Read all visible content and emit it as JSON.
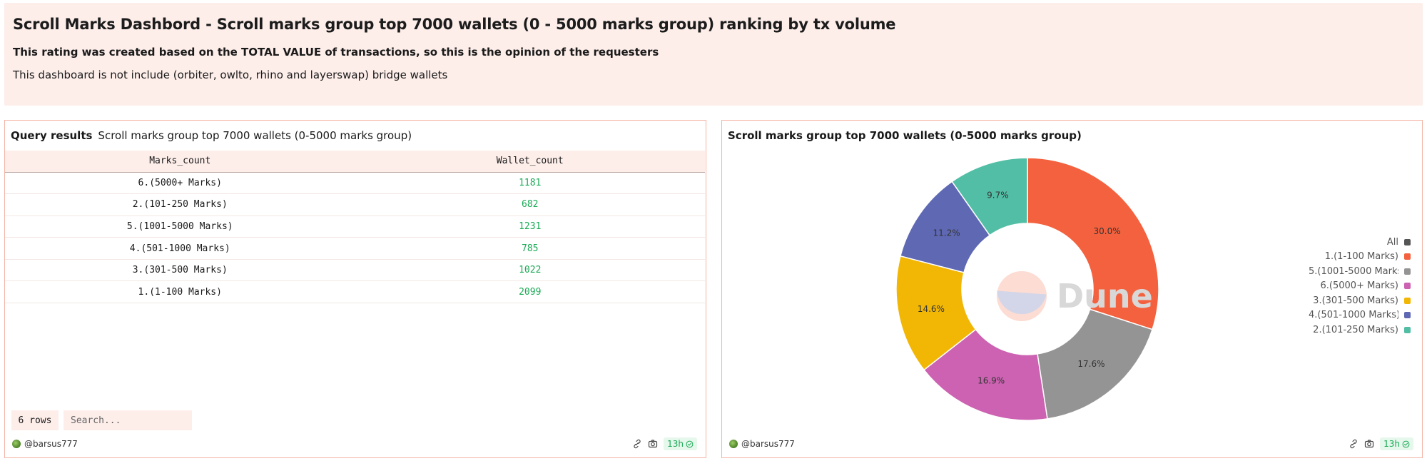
{
  "header": {
    "title": "Scroll Marks Dashbord - Scroll marks group top 7000 wallets (0 - 5000 marks group) ranking by tx volume",
    "line1": "This rating was created based on the TOTAL VALUE of transactions, so this is the opinion of the requesters",
    "line2": "This dashboard is not include (orbiter, owlto, rhino and layerswap) bridge wallets"
  },
  "table_panel": {
    "title_strong": "Query results",
    "title": "Scroll marks group top 7000 wallets (0-5000 marks group)",
    "columns": [
      "Marks_count",
      "Wallet_count"
    ],
    "rows": [
      [
        "6.(5000+ Marks)",
        "1181"
      ],
      [
        "2.(101-250 Marks)",
        "682"
      ],
      [
        "5.(1001-5000 Marks)",
        "1231"
      ],
      [
        "4.(501-1000 Marks)",
        "785"
      ],
      [
        "3.(301-500 Marks)",
        "1022"
      ],
      [
        "1.(1-100 Marks)",
        "2099"
      ]
    ],
    "rows_label": "6 rows",
    "search_placeholder": "Search...",
    "user": "@barsus777",
    "age": "13h"
  },
  "chart_panel": {
    "title": "Scroll marks group top 7000 wallets (0-5000 marks group)",
    "user": "@barsus777",
    "age": "13h",
    "watermark": "Dune",
    "legend_all": "All",
    "legend_all_color": "#555555"
  },
  "chart_data": {
    "type": "pie",
    "donut": true,
    "slices": [
      {
        "label": "1.(1-100 Marks)",
        "value": 2099,
        "pct": "30.0%",
        "color": "#f4613e"
      },
      {
        "label": "5.(1001-5000 Marks)",
        "value": 1231,
        "pct": "17.6%",
        "color": "#949494"
      },
      {
        "label": "6.(5000+ Marks)",
        "value": 1181,
        "pct": "16.9%",
        "color": "#cc62b1"
      },
      {
        "label": "3.(301-500 Marks)",
        "value": 1022,
        "pct": "14.6%",
        "color": "#f2b705"
      },
      {
        "label": "4.(501-1000 Marks)",
        "value": 785,
        "pct": "11.2%",
        "color": "#5e68b3"
      },
      {
        "label": "2.(101-250 Marks)",
        "value": 682,
        "pct": "9.7%",
        "color": "#52bea5"
      }
    ],
    "legend_position": "right"
  }
}
